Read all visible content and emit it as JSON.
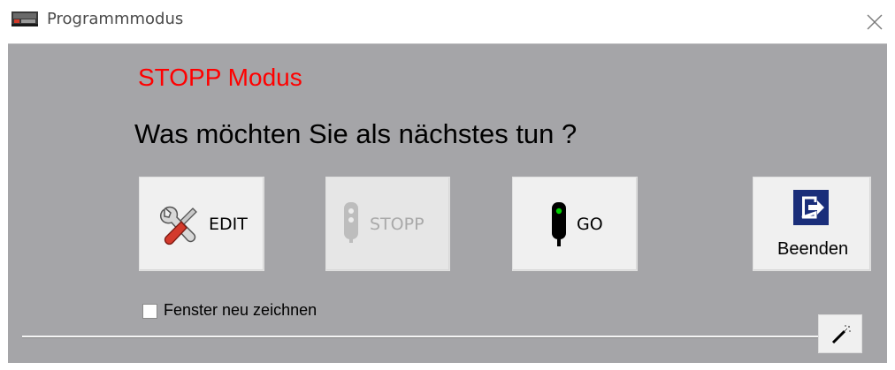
{
  "window": {
    "title": "Programmmodus",
    "app_icon": "locomotive-icon",
    "close_icon": "close-icon"
  },
  "main": {
    "mode_title": "STOPP Modus",
    "question": "Was möchten Sie als nächstes tun ?"
  },
  "buttons": {
    "edit": {
      "label": "EDIT",
      "icon": "tools-icon",
      "enabled": true
    },
    "stopp": {
      "label": "STOPP",
      "icon": "stop-signal-icon",
      "enabled": false
    },
    "go": {
      "label": "GO",
      "icon": "green-signal-icon",
      "enabled": true
    },
    "beenden": {
      "label": "Beenden",
      "icon": "exit-icon",
      "enabled": true
    }
  },
  "options": {
    "redraw_label": "Fenster neu zeichnen",
    "redraw_checked": false
  },
  "tools": {
    "wand_icon": "magic-wand-icon"
  },
  "colors": {
    "client_bg": "#a5a5a8",
    "mode_title": "#ff0000",
    "exit_icon_bg": "#1a2e7a",
    "signal_green": "#00d000"
  }
}
